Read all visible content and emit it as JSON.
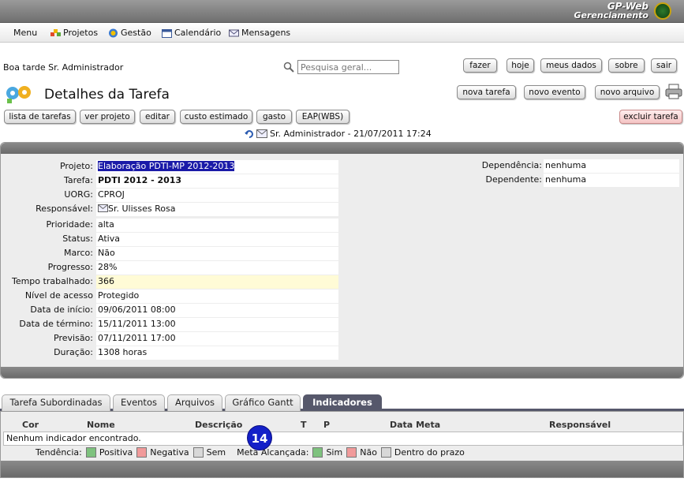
{
  "brand": {
    "line1": "GP-Web",
    "line2": "Gerenciamento"
  },
  "menu": {
    "items": [
      {
        "label": "Menu",
        "icon": "none"
      },
      {
        "label": "Projetos",
        "icon": "projects-icon"
      },
      {
        "label": "Gestão",
        "icon": "management-icon"
      },
      {
        "label": "Calendário",
        "icon": "calendar-icon"
      },
      {
        "label": "Mensagens",
        "icon": "mail-icon"
      }
    ]
  },
  "header": {
    "greeting": "Boa tarde Sr. Administrador",
    "search_placeholder": "Pesquisa geral...",
    "top_buttons": [
      "fazer",
      "hoje",
      "meus dados",
      "sobre",
      "sair"
    ],
    "page_title": "Detalhes da Tarefa",
    "action_buttons": [
      "nova tarefa",
      "novo evento",
      "novo arquivo"
    ],
    "toolbar_buttons": [
      "lista de tarefas",
      "ver projeto",
      "editar",
      "custo estimado",
      "gasto",
      "EAP(WBS)"
    ],
    "delete_button": "excluir tarefa",
    "author_line": "Sr. Administrador - 21/07/2011 17:24"
  },
  "details": {
    "fields": [
      {
        "label": "Projeto:",
        "value": "Elaboração PDTI-MP 2012-2013"
      },
      {
        "label": "Tarefa:",
        "value": "PDTI 2012 - 2013"
      },
      {
        "label": "UORG:",
        "value": "CPROJ"
      },
      {
        "label": "Responsável:",
        "value": "Sr. Ulisses Rosa"
      },
      {
        "label": "Prioridade:",
        "value": "alta"
      },
      {
        "label": "Status:",
        "value": "Ativa"
      },
      {
        "label": "Marco:",
        "value": "Não"
      },
      {
        "label": "Progresso:",
        "value": "28%"
      },
      {
        "label": "Tempo trabalhado:",
        "value": "366"
      },
      {
        "label": "Nível de acesso",
        "value": "Protegido"
      },
      {
        "label": "Data de início:",
        "value": "09/06/2011 08:00"
      },
      {
        "label": "Data de término:",
        "value": "15/11/2011 13:00"
      },
      {
        "label": "Previsão:",
        "value": "07/11/2011 17:00"
      },
      {
        "label": "Duração:",
        "value": "1308 horas"
      }
    ],
    "dependencies": [
      {
        "label": "Dependência:",
        "value": "nenhuma"
      },
      {
        "label": "Dependente:",
        "value": "nenhuma"
      }
    ]
  },
  "tabs": [
    "Tarefa Subordinadas",
    "Eventos",
    "Arquivos",
    "Gráfico Gantt",
    "Indicadores"
  ],
  "active_tab": "Indicadores",
  "indicators": {
    "columns": [
      "Cor",
      "Nome",
      "Descrição",
      "T",
      "P",
      "Data Meta",
      "Responsável"
    ],
    "empty_message": "Nenhum indicador encontrado.",
    "legend": {
      "tendencia_label": "Tendência:",
      "positiva": "Positiva",
      "negativa": "Negativa",
      "sem": "Sem",
      "meta_label": "Meta Alcançada:",
      "sim": "Sim",
      "nao": "Não",
      "prazo": "Dentro do prazo"
    }
  },
  "badge": "14",
  "colors": {
    "banner": "#7a7a7a",
    "active_tab": "#56586b",
    "selection": "#1a1aa8",
    "green": "#7ec27e",
    "red": "#f19a9a",
    "gray": "#d8d8d8",
    "badge": "#1420c8"
  }
}
